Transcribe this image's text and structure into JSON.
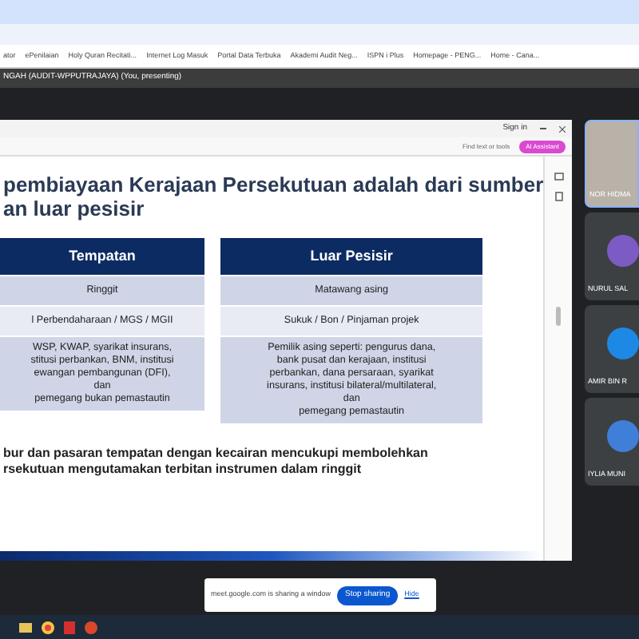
{
  "bookmarks": [
    "ator",
    "ePenilaian",
    "Holy Quran Recitati...",
    "Internet Log Masuk",
    "Portal Data Terbuka",
    "Akademi Audit Neg...",
    "ISPN i Plus",
    "Homepage - PENG...",
    "Home - Cana..."
  ],
  "meeting_header": "NGAH (AUDIT-WPPUTRAJAYA) (You, presenting)",
  "viewer": {
    "sign_in": "Sign in",
    "search_placeholder": "Find text or tools",
    "action_button": "AI Assistant"
  },
  "slide": {
    "title_lines": [
      "pembiayaan Kerajaan Persekutuan adalah dari sumber",
      "an luar pesisir"
    ],
    "columns": [
      {
        "heading": "Tempatan",
        "rows": [
          [
            "Ringgit"
          ],
          [
            "l Perbendaharaan / MGS / MGII"
          ],
          [
            "WSP, KWAP, syarikat insurans,",
            "stitusi perbankan, BNM, institusi",
            "ewangan pembangunan (DFI),",
            "dan",
            "pemegang bukan pemastautin"
          ]
        ]
      },
      {
        "heading": "Luar Pesisir",
        "rows": [
          [
            "Matawang asing"
          ],
          [
            "Sukuk / Bon / Pinjaman projek"
          ],
          [
            "Pemilik asing seperti: pengurus dana,",
            "bank pusat dan kerajaan, institusi",
            "perbankan, dana persaraan, syarikat",
            "insurans, institusi bilateral/multilateral,",
            "dan",
            "pemegang pemastautin"
          ]
        ]
      }
    ],
    "footer_lines": [
      "bur dan pasaran tempatan dengan kecairan mencukupi membolehkan",
      "rsekutuan mengutamakan terbitan instrumen dalam ringgit"
    ]
  },
  "participants": [
    {
      "name": "NOR HIDMA",
      "kind": "video"
    },
    {
      "name": "NURUL SAL",
      "kind": "avatar",
      "color": "#7c5cc4"
    },
    {
      "name": "AMIR BIN R",
      "kind": "avatar",
      "color": "#1e88e5"
    },
    {
      "name": "IYLIA MUNI",
      "kind": "avatar",
      "color": "#3f7fd8"
    }
  ],
  "share_notice": {
    "message": "meet.google.com is sharing a window",
    "stop_button": "Stop sharing",
    "hide_link": "Hide"
  }
}
